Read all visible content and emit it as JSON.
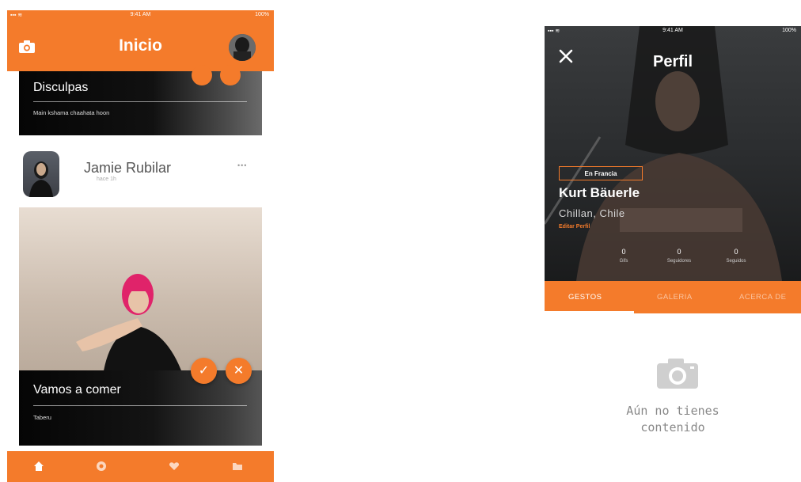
{
  "colors": {
    "accent": "#f47b2b",
    "white": "#ffffff",
    "dark": "#111111"
  },
  "left_screen": {
    "status": {
      "time": "9:41 AM",
      "battery": "100%"
    },
    "header": {
      "title": "Inicio",
      "left_icon": "camera-icon",
      "right_icon": "avatar"
    },
    "card1": {
      "title": "Disculpas",
      "subtitle": "Main kshama chaahata hoon"
    },
    "post": {
      "author": "Jamie Rubilar",
      "time": "hace 1h",
      "more": "•••",
      "caption_title": "Vamos a comer",
      "caption_subtitle": "Taberu",
      "accept_icon": "check-icon",
      "reject_icon": "close-icon",
      "accept_glyph": "✓",
      "reject_glyph": "✕"
    },
    "tabbar": {
      "items": [
        "home-icon",
        "explore-icon",
        "heart-icon",
        "folder-icon"
      ]
    }
  },
  "right_screen": {
    "status": {
      "time": "9:41 AM",
      "battery": "100%"
    },
    "header": {
      "title": "Perfil",
      "close_glyph": "✕"
    },
    "profile": {
      "badge": "En Francia",
      "name": "Kurt Bäuerle",
      "location": "Chillan, Chile",
      "edit_label": "Editar Perfil"
    },
    "stats": [
      {
        "value": "0",
        "label": "Gifs"
      },
      {
        "value": "0",
        "label": "Seguidores"
      },
      {
        "value": "0",
        "label": "Seguidos"
      }
    ],
    "tabs": [
      "GESTOS",
      "GALERIA",
      "ACERCA DE"
    ],
    "active_tab": "GESTOS",
    "empty_state": {
      "icon": "camera-icon",
      "line1": "Aún no tienes",
      "line2": "contenido"
    }
  }
}
